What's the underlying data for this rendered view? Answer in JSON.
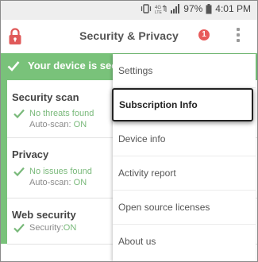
{
  "status_bar": {
    "network_label": "4G LTE",
    "battery_percent": "97%",
    "time": "4:01 PM"
  },
  "app_bar": {
    "title": "Security & Privacy",
    "alert_count": "1"
  },
  "banner": {
    "text": "Your device is sec"
  },
  "sections": [
    {
      "title": "Security scan",
      "status": "No threats found",
      "sub_label": "Auto-scan: ",
      "sub_value": "ON"
    },
    {
      "title": "Privacy",
      "status": "No issues found",
      "sub_label": "Auto-scan: ",
      "sub_value": "ON"
    },
    {
      "title": "Web security",
      "status": "Security: ",
      "status_value": "ON"
    }
  ],
  "menu": {
    "items": [
      "Settings",
      "Subscription Info",
      "Device info",
      "Activity report",
      "Open source licenses",
      "About us"
    ],
    "selected": "Subscription Info"
  },
  "colors": {
    "accent_green": "#79c27a",
    "alert_red": "#e85b5b",
    "lock_red": "#e05a5a"
  }
}
